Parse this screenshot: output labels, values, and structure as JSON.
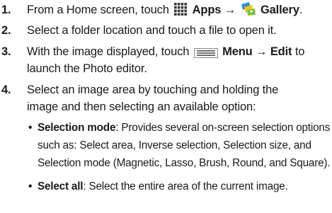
{
  "steps": [
    {
      "number": "1.",
      "pre": "From a Home screen, touch",
      "apps_icon": "apps-grid-icon",
      "apps_label": "Apps",
      "arrow": "→",
      "gallery_icon": "gallery-icon",
      "gallery_label": "Gallery",
      "end": "."
    },
    {
      "number": "2.",
      "text": "Select a folder location and touch a file to open it."
    },
    {
      "number": "3.",
      "pre": "With the image displayed, touch",
      "menu_icon": "menu-key-icon",
      "menu_label": "Menu",
      "arrow": "→",
      "edit_label": "Edit",
      "post": "to",
      "line2": "launch the Photo editor."
    },
    {
      "number": "4.",
      "line1": "Select an image area by touching and holding the",
      "line2": "image and then selecting an available option:"
    }
  ],
  "bullets": [
    {
      "dot": "•",
      "term": "Selection mode",
      "colon": ":",
      "line1": "Provides several on-screen selection options",
      "line2": "such as: Select area, Inverse selection, Selection size, and",
      "line3": "Selection mode (Magnetic, Lasso, Brush, Round, and Square)."
    },
    {
      "dot": "•",
      "term": "Select all",
      "colon": ":",
      "line1": "Select the entire area of the current image."
    }
  ],
  "colors": {
    "text": "#1a1a1a",
    "apps_icon_dark": "#3a3a3a",
    "gallery_green": "#7bc142",
    "gallery_yellow": "#f5c400",
    "gallery_blue": "#2f8fd8",
    "menu_icon_border": "#8a8a8a"
  }
}
